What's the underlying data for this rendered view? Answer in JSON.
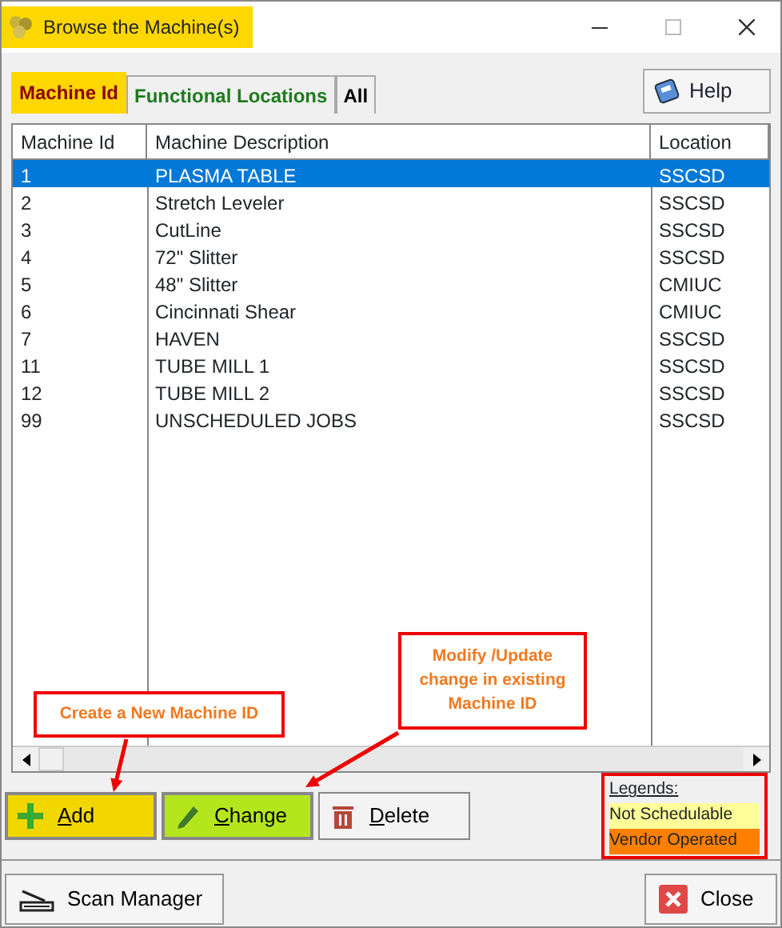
{
  "window": {
    "title": "Browse the Machine(s)"
  },
  "tabs": [
    {
      "label": "Machine Id",
      "selected": true
    },
    {
      "label": "Functional Locations",
      "selected": false
    },
    {
      "label": "All",
      "selected": false
    }
  ],
  "help_button": {
    "label": "Help"
  },
  "table": {
    "columns": [
      "Machine Id",
      "Machine Description",
      "Location"
    ],
    "rows": [
      {
        "cells": [
          "1",
          "PLASMA TABLE",
          "SSCSD"
        ],
        "selected": true
      },
      {
        "cells": [
          "2",
          "Stretch Leveler",
          "SSCSD"
        ],
        "selected": false
      },
      {
        "cells": [
          "3",
          "CutLine",
          "SSCSD"
        ],
        "selected": false
      },
      {
        "cells": [
          "4",
          "72\" Slitter",
          "SSCSD"
        ],
        "selected": false
      },
      {
        "cells": [
          "5",
          "48\" Slitter",
          "CMIUC"
        ],
        "selected": false
      },
      {
        "cells": [
          "6",
          "Cincinnati Shear",
          "CMIUC"
        ],
        "selected": false
      },
      {
        "cells": [
          "7",
          "HAVEN",
          "SSCSD"
        ],
        "selected": false
      },
      {
        "cells": [
          "11",
          "TUBE MILL 1",
          "SSCSD"
        ],
        "selected": false
      },
      {
        "cells": [
          "12",
          "TUBE MILL 2",
          "SSCSD"
        ],
        "selected": false
      },
      {
        "cells": [
          "99",
          "UNSCHEDULED JOBS",
          "SSCSD"
        ],
        "selected": false
      }
    ]
  },
  "actions": [
    {
      "kind": "add",
      "label": "Add",
      "color": "#f2d600"
    },
    {
      "kind": "change",
      "label": "Change",
      "color": "#b5e61d"
    },
    {
      "kind": "delete",
      "label": "Delete"
    }
  ],
  "legend": {
    "title": "Legends:",
    "items": [
      {
        "label": "Not Schedulable",
        "color": "#ffff99"
      },
      {
        "label": "Vendor Operated",
        "color": "#ff7f00"
      }
    ]
  },
  "footer": [
    {
      "kind": "scan",
      "label": "Scan Manager"
    },
    {
      "kind": "close",
      "label": "Close"
    }
  ],
  "annotations": [
    {
      "kind": "add",
      "lines": [
        "Create a New Machine ID"
      ]
    },
    {
      "kind": "change",
      "lines": [
        "Modify /Update",
        "change in existing",
        "Machine ID"
      ]
    }
  ]
}
